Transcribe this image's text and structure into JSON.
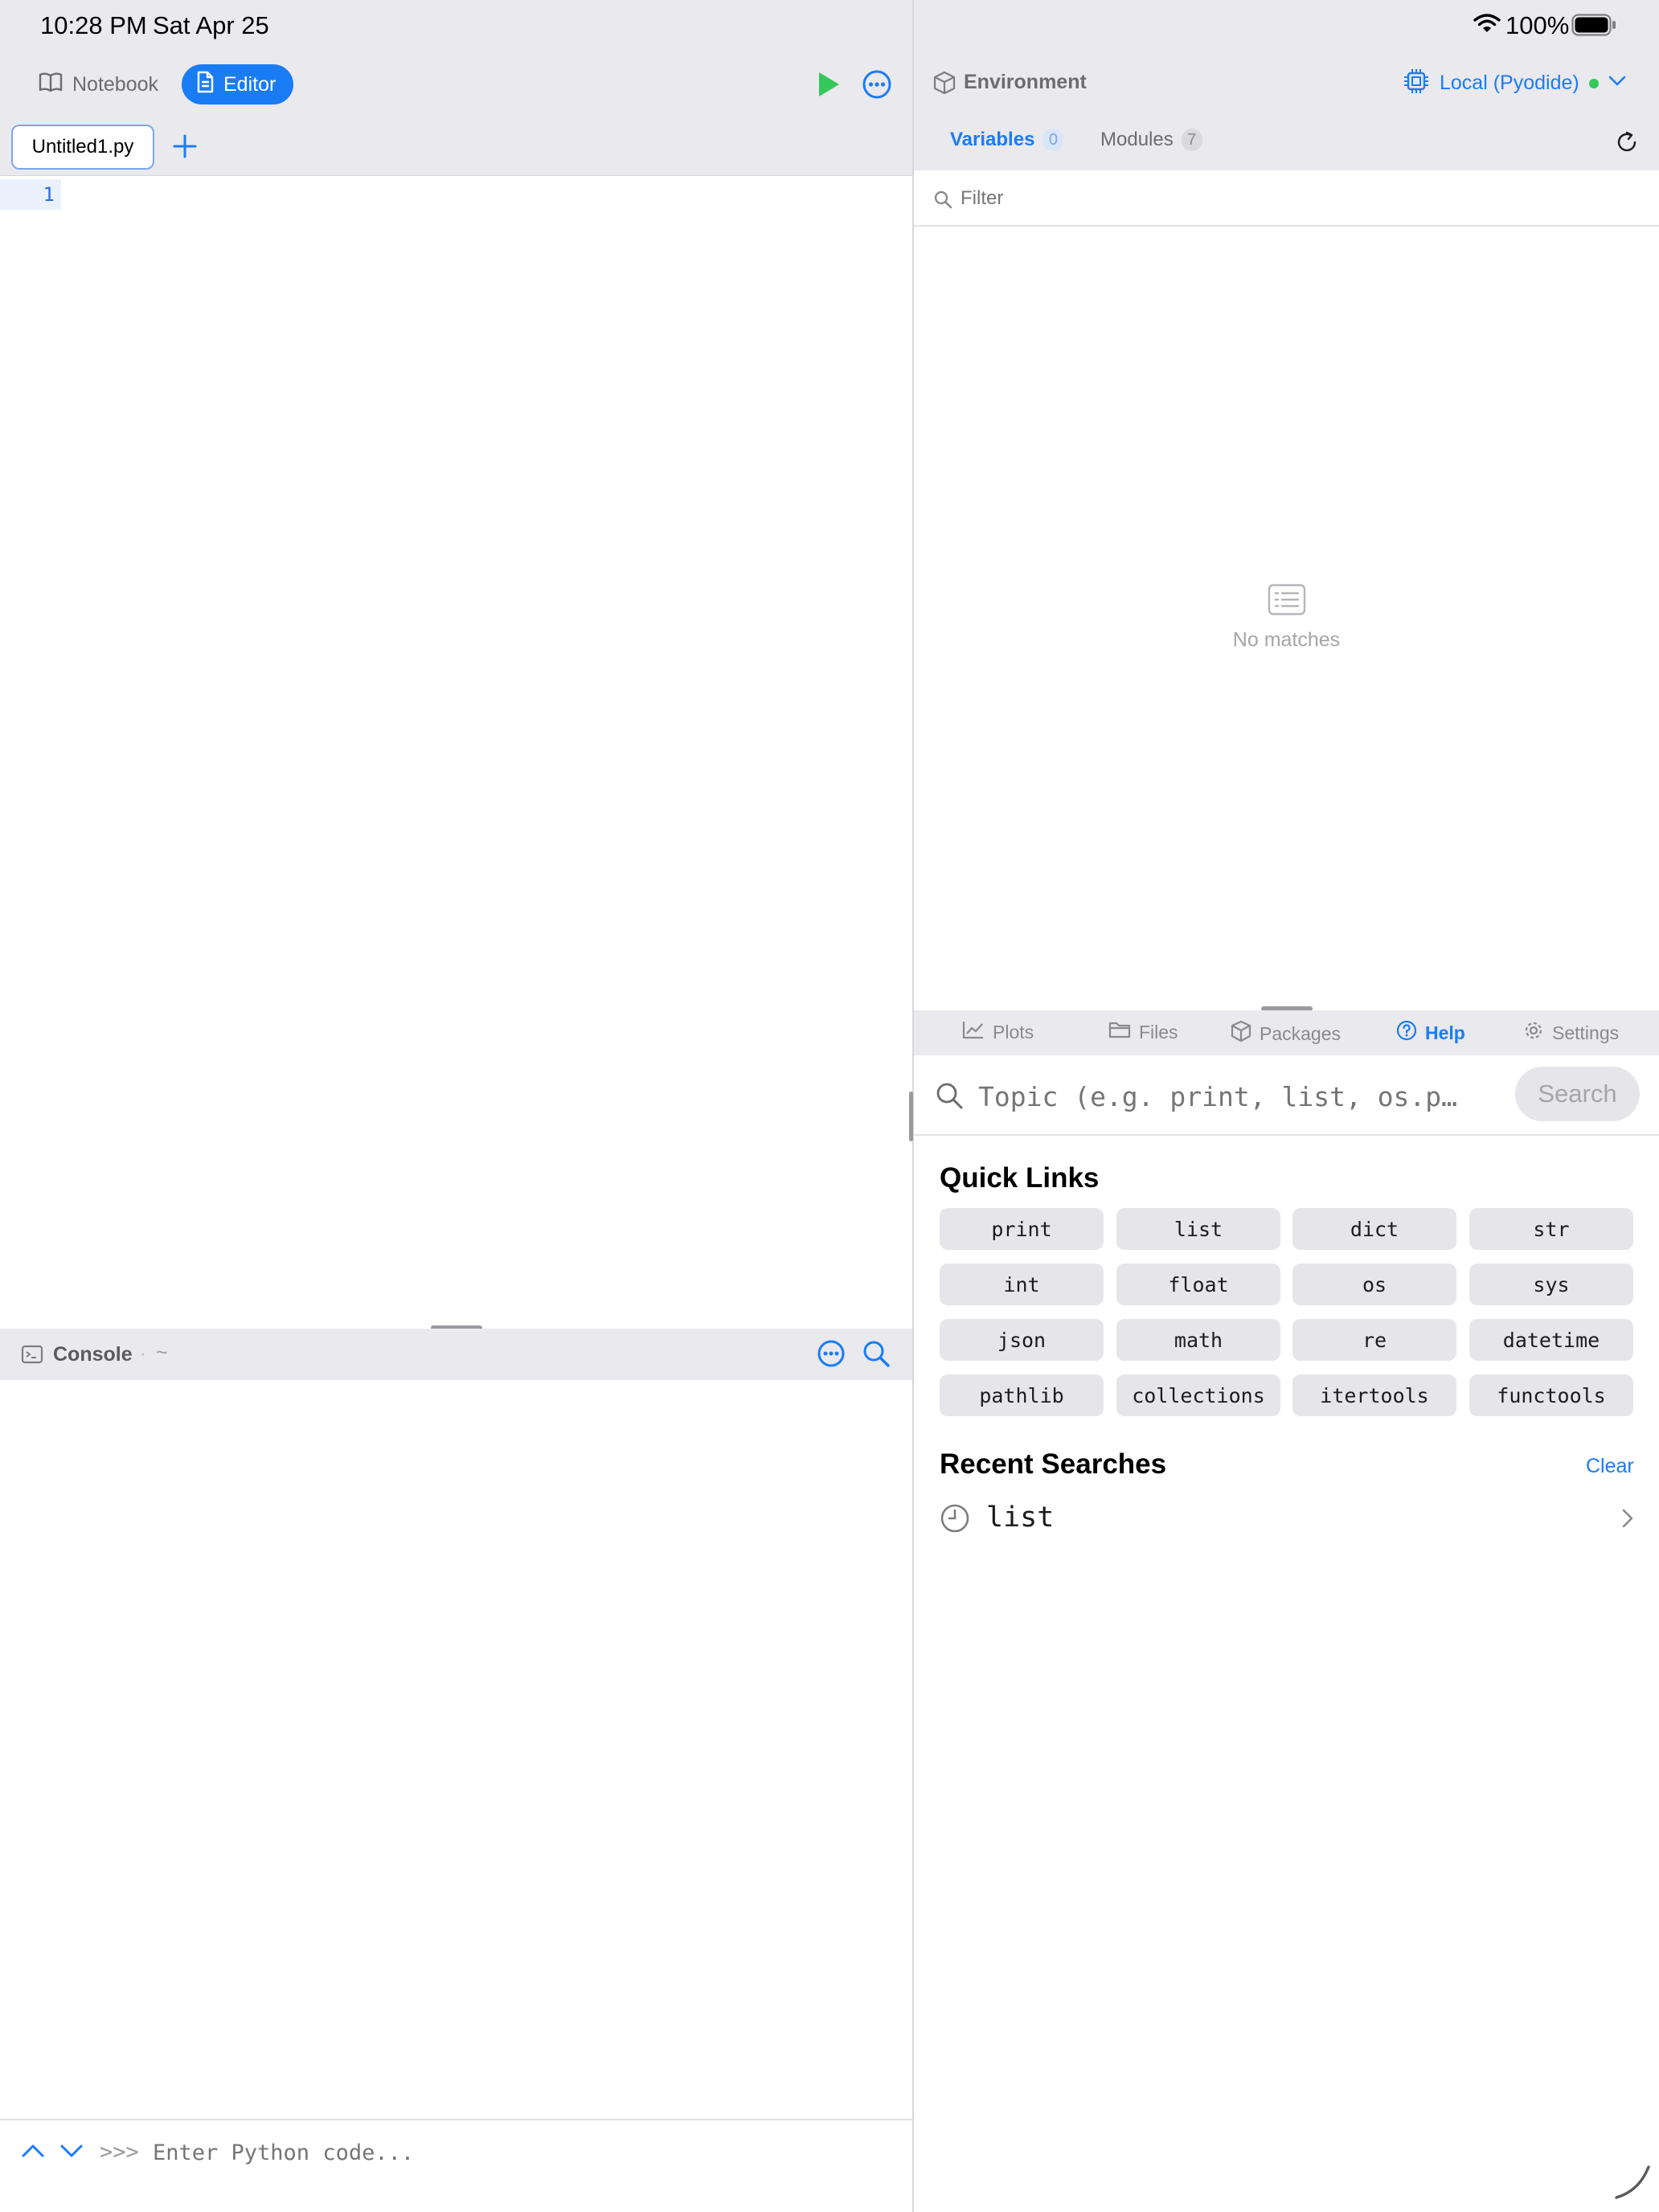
{
  "status_bar": {
    "time": "10:28 PM",
    "date": "Sat Apr 25",
    "battery": "100%"
  },
  "modes": {
    "notebook_label": "Notebook",
    "editor_label": "Editor"
  },
  "editor": {
    "tab_name": "Untitled1.py",
    "line_numbers": [
      "1"
    ]
  },
  "console": {
    "title": "Console",
    "path": "~",
    "separator": "·",
    "prompt": ">>>",
    "placeholder": "Enter Python code..."
  },
  "environment": {
    "title": "Environment",
    "kernel_label": "Local (Pyodide)",
    "variables_label": "Variables",
    "variables_count": "0",
    "modules_label": "Modules",
    "modules_count": "7",
    "filter_placeholder": "Filter",
    "empty_message": "No matches"
  },
  "bottom_tabs": [
    {
      "label": "Plots",
      "icon": "chart-icon"
    },
    {
      "label": "Files",
      "icon": "folder-icon"
    },
    {
      "label": "Packages",
      "icon": "package-icon"
    },
    {
      "label": "Help",
      "icon": "help-icon",
      "active": true
    },
    {
      "label": "Settings",
      "icon": "gear-icon"
    }
  ],
  "help": {
    "search_placeholder": "Topic (e.g. print, list, os.p…",
    "search_button": "Search",
    "quick_links_title": "Quick Links",
    "quick_links": [
      "print",
      "list",
      "dict",
      "str",
      "int",
      "float",
      "os",
      "sys",
      "json",
      "math",
      "re",
      "datetime",
      "pathlib",
      "collections",
      "itertools",
      "functools"
    ],
    "recent_title": "Recent Searches",
    "clear_label": "Clear",
    "recent_items": [
      "list"
    ]
  },
  "colors": {
    "accent": "#1a7cf5",
    "run_green": "#34c759",
    "header_bg": "#e9e9ee",
    "kernel_status": "#34c759"
  }
}
